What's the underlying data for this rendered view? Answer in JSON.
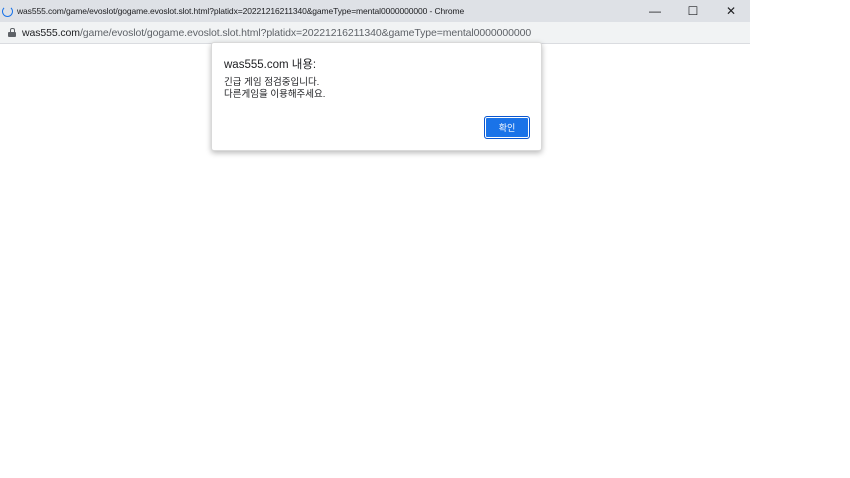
{
  "window": {
    "title": "was555.com/game/evoslot/gogame.evoslot.slot.html?platidx=20221216211340&gameType=mental0000000000 - Chrome",
    "controls": {
      "minimize": "—",
      "maximize": "☐",
      "close": "✕"
    }
  },
  "addressbar": {
    "host": "was555.com",
    "path": "/game/evoslot/gogame.evoslot.slot.html?platidx=20221216211340&gameType=mental0000000000"
  },
  "dialog": {
    "title": "was555.com 내용:",
    "message_line1": "긴급 게임 점검중입니다.",
    "message_line2": "다른게임을 이용해주세요.",
    "ok_label": "확인"
  },
  "colors": {
    "accent": "#1a73e8",
    "titlebar": "#dee1e6",
    "addressbar": "#f1f3f4"
  },
  "icons": {
    "tab": "loading-spinner-icon",
    "address": "lock-icon"
  }
}
